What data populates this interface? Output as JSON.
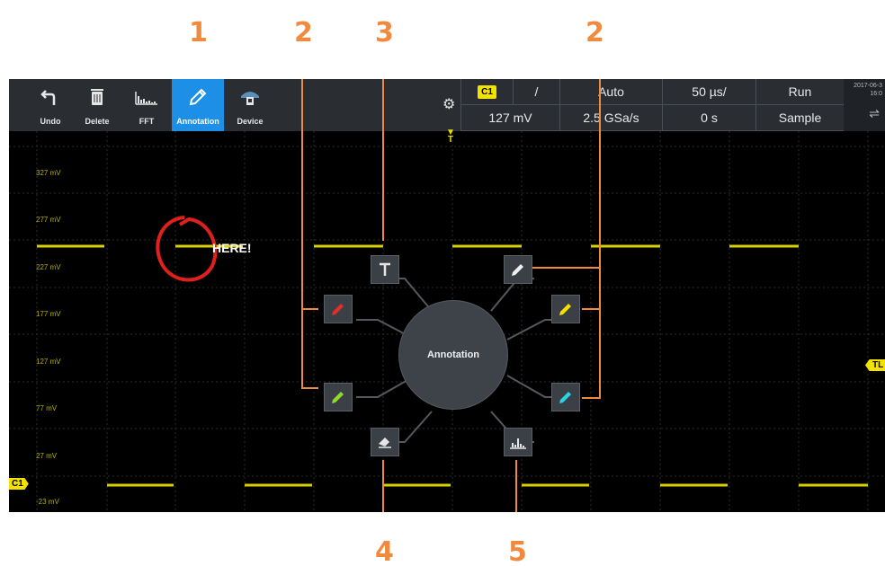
{
  "callouts": [
    "1",
    "2",
    "3",
    "2",
    "4",
    "5"
  ],
  "toolbar": {
    "items": [
      {
        "label": "Undo",
        "icon": "undo-arrow-icon"
      },
      {
        "label": "Delete",
        "icon": "trash-icon"
      },
      {
        "label": "FFT",
        "icon": "fft-spectrum-icon"
      },
      {
        "label": "Annotation",
        "icon": "pencil-icon"
      },
      {
        "label": "Device",
        "icon": "device-icon"
      }
    ],
    "active_index": 3
  },
  "status": {
    "channel": "C1",
    "trigger_slope": "/",
    "trigger_mode": "Auto",
    "time_per_div": "50 µs/",
    "run_state": "Run",
    "trigger_level": "127 mV",
    "sample_rate": "2.5 GSa/s",
    "time_offset": "0 s",
    "acquisition_mode": "Sample"
  },
  "datetime": [
    "2017-06-3",
    "16:0"
  ],
  "grid": {
    "y_labels": [
      "327 mV",
      "277 mV",
      "227 mV",
      "177 mV",
      "127 mV",
      "77 mV",
      "27 mV",
      "-23 mV"
    ]
  },
  "markers": {
    "channel_left": "C1",
    "trigger_top": "T",
    "trigger_right": "TL"
  },
  "annotation_text": "HERE!",
  "wheel": {
    "center_label": "Annotation",
    "buttons": [
      {
        "name": "text-tool",
        "icon": "text-t-icon"
      },
      {
        "name": "red-pen",
        "icon": "pencil-icon",
        "color": "#e0302a"
      },
      {
        "name": "green-pen",
        "icon": "pencil-icon",
        "color": "#8fd92a"
      },
      {
        "name": "eraser",
        "icon": "eraser-icon"
      },
      {
        "name": "white-pen",
        "icon": "pencil-icon",
        "color": "#f0f0f0"
      },
      {
        "name": "yellow-pen",
        "icon": "pencil-icon",
        "color": "#f2e200"
      },
      {
        "name": "cyan-pen",
        "icon": "pencil-icon",
        "color": "#2ad6e6"
      },
      {
        "name": "background-fft",
        "icon": "fft-spectrum-icon"
      }
    ]
  },
  "colors": {
    "accent_callout": "#f08a3e",
    "channel1": "#e6e000",
    "active_tool": "#1d8fe6"
  }
}
